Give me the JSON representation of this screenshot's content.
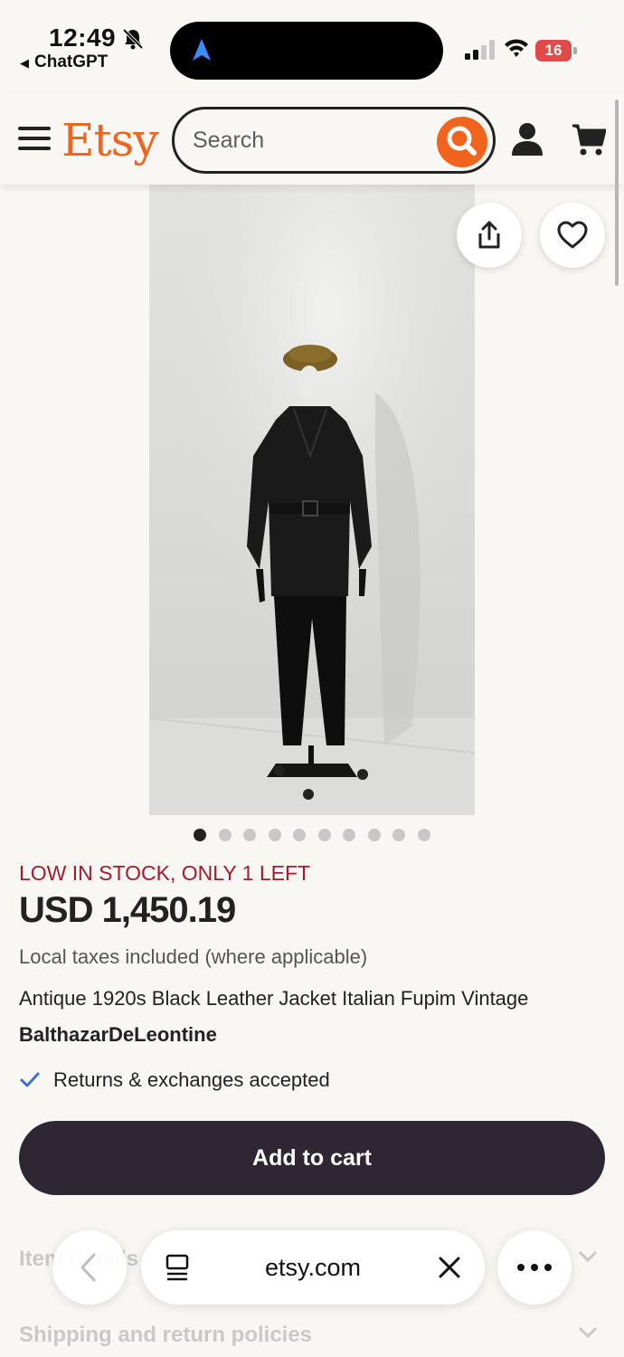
{
  "status_bar": {
    "time": "12:49",
    "back_app": "ChatGPT",
    "battery": "16"
  },
  "header": {
    "logo": "Etsy",
    "search_placeholder": "Search"
  },
  "carousel": {
    "total_images": 10,
    "active_index": 0
  },
  "product": {
    "stock_label": "LOW IN STOCK, ONLY 1 LEFT",
    "price": "USD 1,450.19",
    "tax_note": "Local taxes included (where applicable)",
    "title": "Antique 1920s Black Leather Jacket Italian Fupim Vintage",
    "shop_name": "BalthazarDeLeontine",
    "returns": "Returns & exchanges accepted",
    "add_to_cart_label": "Add to cart"
  },
  "accordions": [
    {
      "label": "Item details"
    },
    {
      "label": "Shipping and return policies"
    }
  ],
  "browser_toolbar": {
    "url": "etsy.com"
  },
  "colors": {
    "accent": "#f1641e",
    "stock_red": "#a61a2e",
    "button_dark": "#2e2733",
    "check_blue": "#3b6fd4"
  }
}
